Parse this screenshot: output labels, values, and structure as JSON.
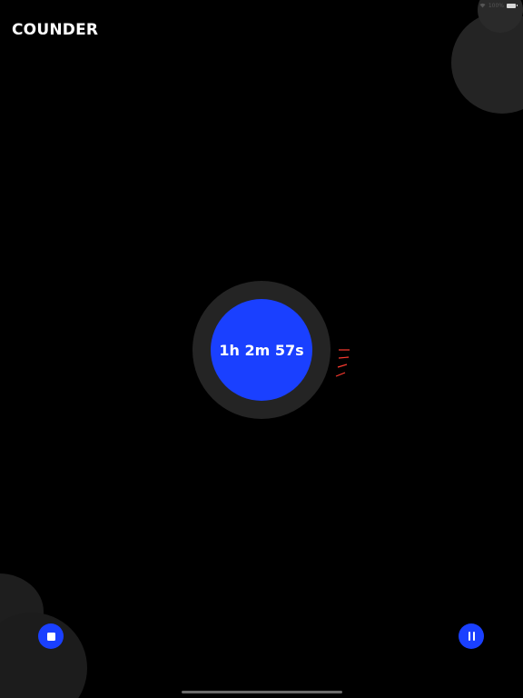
{
  "app": {
    "title": "COUNDER"
  },
  "status_bar": {
    "battery_text": "100%",
    "icons": [
      "wifi-icon",
      "battery-icon"
    ]
  },
  "timer": {
    "display": "1h 2m 57s",
    "accent_color": "#1a40ff",
    "tick_color": "#ff3b30"
  },
  "controls": {
    "stop": {
      "icon": "stop-icon"
    },
    "pause": {
      "icon": "pause-icon"
    }
  }
}
